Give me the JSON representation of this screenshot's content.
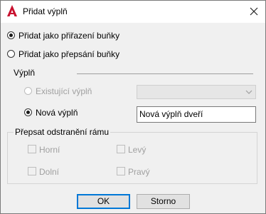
{
  "window": {
    "title": "Přidat výplň",
    "icon": "autocad-icon",
    "close_icon": "close-icon"
  },
  "mode": {
    "option_cell_assignment": "Přidat jako přiřazení buňky",
    "option_cell_override": "Přidat jako přepsání buňky",
    "selected": "option_cell_assignment"
  },
  "fill": {
    "section_label": "Výplň",
    "existing_label": "Existující výplň",
    "existing_value": "",
    "new_label": "Nová výplň",
    "new_value": "Nová výplň dveří",
    "selected": "new"
  },
  "frame": {
    "group_label": "Přepsat odstranění rámu",
    "top_label": "Horní",
    "left_label": "Levý",
    "bottom_label": "Dolní",
    "right_label": "Pravý"
  },
  "buttons": {
    "ok": "OK",
    "cancel": "Storno"
  }
}
